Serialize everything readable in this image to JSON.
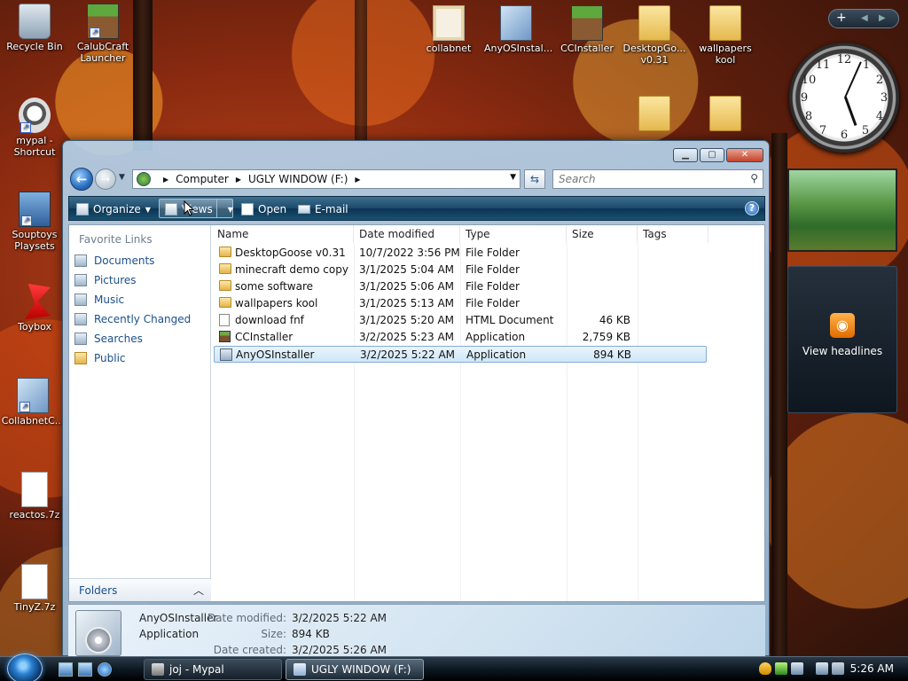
{
  "desktop": {
    "icons_left": [
      {
        "label": "Recycle Bin",
        "icon": "recycle-bin-icon"
      },
      {
        "label": "CalubCraft Launcher",
        "icon": "grass-block-icon"
      },
      {
        "label": "mypal - Shortcut",
        "icon": "raccoon-icon"
      },
      {
        "label": "Souptoys Playsets",
        "icon": "window-screen-icon"
      },
      {
        "label": "Toybox",
        "icon": "red-s-icon"
      },
      {
        "label": "CollabnetC...",
        "icon": "shield-installer-icon"
      },
      {
        "label": "reactos.7z",
        "icon": "blank-file-icon"
      },
      {
        "label": "TinyZ.7z",
        "icon": "blank-file-icon"
      }
    ],
    "icons_top": [
      {
        "label": "collabnet",
        "icon": "certificate-icon"
      },
      {
        "label": "AnyOSInstal...",
        "icon": "installer-box-icon"
      },
      {
        "label": "CCInstaller",
        "icon": "grass-block-icon"
      },
      {
        "label": "DesktopGo... v0.31",
        "icon": "folder-icon"
      },
      {
        "label": "wallpapers kool",
        "icon": "folder-icon"
      }
    ]
  },
  "sidebar": {
    "add_label": "+",
    "feed_label": "View headlines",
    "clock_numbers": [
      "12",
      "1",
      "2",
      "3",
      "4",
      "5",
      "6",
      "7",
      "8",
      "9",
      "10",
      "11"
    ]
  },
  "window": {
    "address": {
      "segments": [
        "Computer",
        "UGLY WINDOW (F:)"
      ]
    },
    "search_placeholder": "Search",
    "toolbar": {
      "organize": "Organize",
      "views": "Views",
      "open": "Open",
      "email": "E-mail",
      "help": "?"
    },
    "nav": {
      "heading": "Favorite Links",
      "links": [
        "Documents",
        "Pictures",
        "Music",
        "Recently Changed",
        "Searches",
        "Public"
      ],
      "folders_label": "Folders"
    },
    "columns": [
      "Name",
      "Date modified",
      "Type",
      "Size",
      "Tags"
    ],
    "files": [
      {
        "name": "DesktopGoose v0.31",
        "date": "10/7/2022 3:56 PM",
        "type": "File Folder",
        "size": "",
        "icon": "folder"
      },
      {
        "name": "minecraft demo copy",
        "date": "3/1/2025 5:04 AM",
        "type": "File Folder",
        "size": "",
        "icon": "folder"
      },
      {
        "name": "some software",
        "date": "3/1/2025 5:06 AM",
        "type": "File Folder",
        "size": "",
        "icon": "folder"
      },
      {
        "name": "wallpapers kool",
        "date": "3/1/2025 5:13 AM",
        "type": "File Folder",
        "size": "",
        "icon": "folder"
      },
      {
        "name": "download fnf",
        "date": "3/1/2025 5:20 AM",
        "type": "HTML Document",
        "size": "46 KB",
        "icon": "html"
      },
      {
        "name": "CCInstaller",
        "date": "3/2/2025 5:23 AM",
        "type": "Application",
        "size": "2,759 KB",
        "icon": "cube"
      },
      {
        "name": "AnyOSInstaller",
        "date": "3/2/2025 5:22 AM",
        "type": "Application",
        "size": "894 KB",
        "icon": "app",
        "selected": true
      }
    ],
    "details": {
      "name": "AnyOSInstaller",
      "kind": "Application",
      "date_modified_label": "Date modified:",
      "date_modified": "3/2/2025 5:22 AM",
      "size_label": "Size:",
      "size": "894 KB",
      "date_created_label": "Date created:",
      "date_created": "3/2/2025 5:26 AM"
    }
  },
  "taskbar": {
    "tasks": [
      {
        "label": "joj - Mypal",
        "active": false
      },
      {
        "label": "UGLY WINDOW (F:)",
        "active": true
      }
    ],
    "time": "5:26 AM"
  }
}
